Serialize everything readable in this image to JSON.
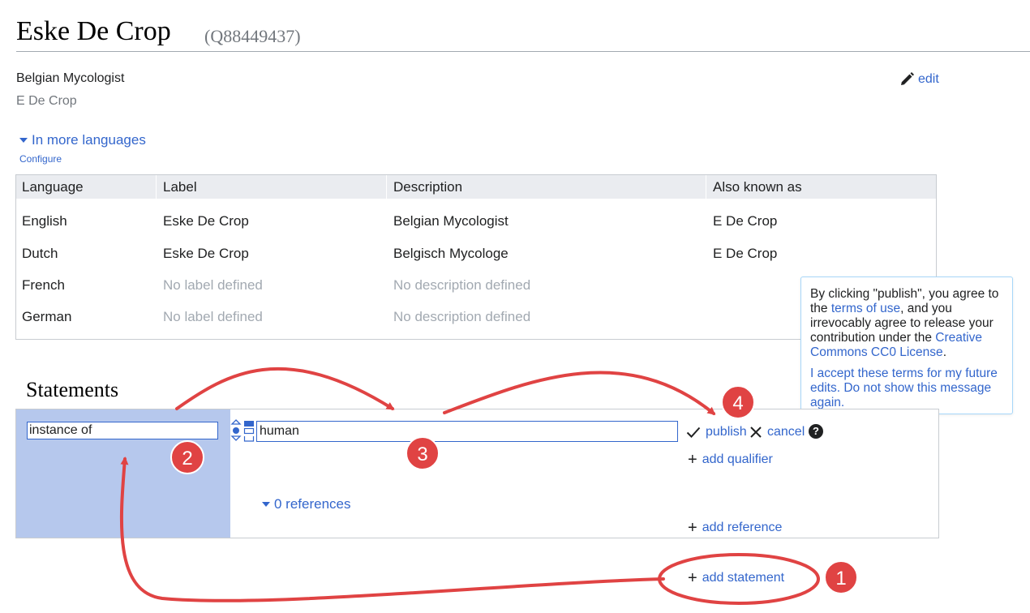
{
  "entity": {
    "title": "Eske De Crop",
    "id": "(Q88449437)",
    "description": "Belgian Mycologist",
    "aliases": "E De Crop",
    "edit_label": "edit"
  },
  "languages": {
    "toggle_label": "In more languages",
    "configure_label": "Configure",
    "headers": [
      "Language",
      "Label",
      "Description",
      "Also known as"
    ],
    "rows": [
      {
        "language": "English",
        "label": "Eske De Crop",
        "description": "Belgian Mycologist",
        "aliases": "E De Crop",
        "label_missing": false,
        "description_missing": false
      },
      {
        "language": "Dutch",
        "label": "Eske De Crop",
        "description": "Belgisch Mycologe",
        "aliases": "E De Crop",
        "label_missing": false,
        "description_missing": false
      },
      {
        "language": "French",
        "label": "No label defined",
        "description": "No description defined",
        "aliases": "",
        "label_missing": true,
        "description_missing": true
      },
      {
        "language": "German",
        "label": "No label defined",
        "description": "No description defined",
        "aliases": "",
        "label_missing": true,
        "description_missing": true
      }
    ]
  },
  "tooltip": {
    "p1_pre": "By clicking \"publish\", you agree to the ",
    "terms_link": "terms of use",
    "p1_mid": ", and you irrevocably agree to release your contribution under the ",
    "license_link": "Creative Commons CC0 License",
    "p1_post": ".",
    "accept_link": "I accept these terms for my future edits. Do not show this message again."
  },
  "statements": {
    "heading": "Statements",
    "property_value": "instance of",
    "value_value": "human",
    "publish_label": "publish",
    "cancel_label": "cancel",
    "help_symbol": "?",
    "add_qualifier_label": "add qualifier",
    "references_label": "0 references",
    "add_reference_label": "add reference",
    "add_statement_label": "add statement"
  },
  "annotations": {
    "badges": [
      "1",
      "2",
      "3",
      "4"
    ],
    "color": "#e04343"
  },
  "colors": {
    "link": "#3366cc",
    "property_column": "#b6c8ed",
    "table_header": "#eaecf0",
    "annotation_red": "#e04343"
  }
}
